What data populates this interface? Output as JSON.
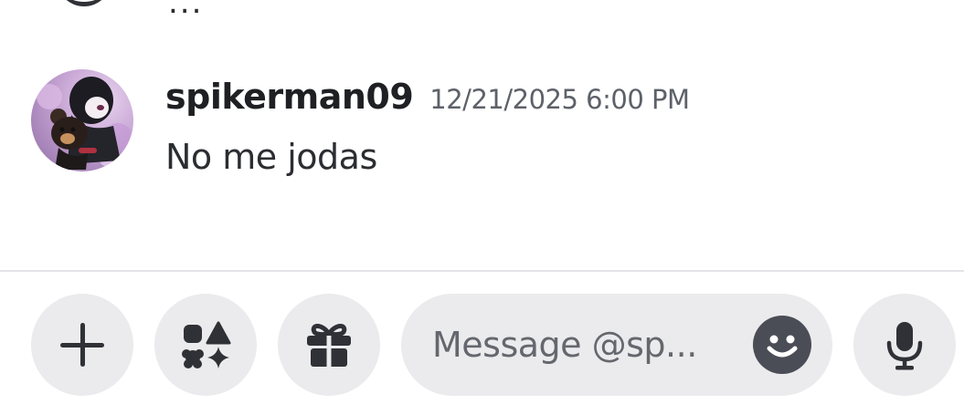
{
  "previous_message": {
    "dots": "..."
  },
  "message": {
    "username": "spikerman09",
    "timestamp": "12/21/2025 6:00 PM",
    "content": "No me jodas",
    "avatar_icon": "user-avatar"
  },
  "composer": {
    "placeholder": "Message @sp...",
    "value": "",
    "buttons": {
      "attach_icon": "plus-icon",
      "apps_icon": "apps-icon",
      "gift_icon": "gift-icon",
      "emoji_icon": "emoji-icon",
      "mic_icon": "microphone-icon"
    }
  },
  "colors": {
    "background": "#ffffff",
    "button_bg": "#ebebed",
    "icon_dark": "#2f3136",
    "username": "#1f2023",
    "timestamp": "#5d6168",
    "divider": "#e4e5e8"
  }
}
